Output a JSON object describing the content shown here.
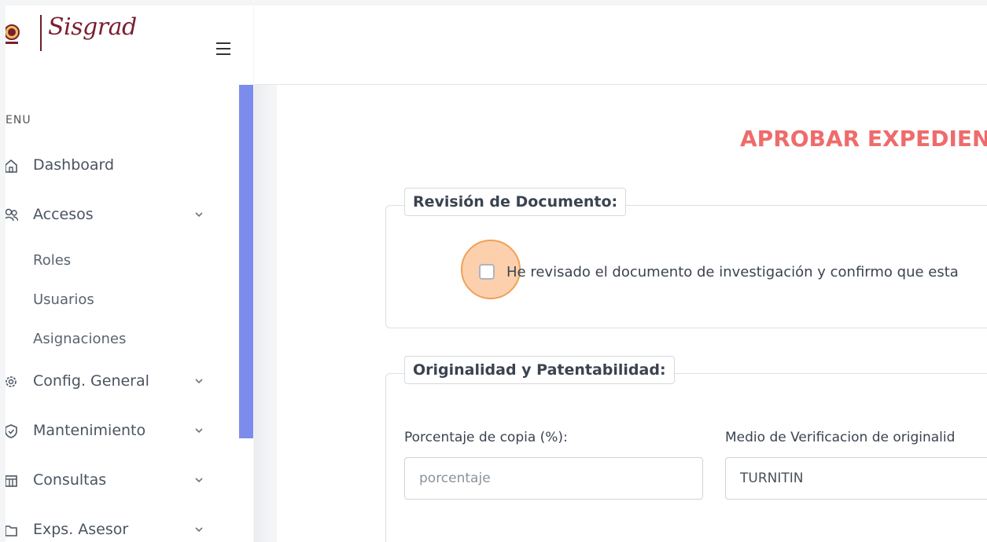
{
  "brand": {
    "name": "Sisgrad"
  },
  "sidebar": {
    "menu_heading": "ENU",
    "items": [
      {
        "label": "Dashboard",
        "icon": "home-icon",
        "has_children": false
      },
      {
        "label": "Accesos",
        "icon": "users-icon",
        "has_children": true,
        "children": [
          "Roles",
          "Usuarios",
          "Asignaciones"
        ]
      },
      {
        "label": "Config. General",
        "icon": "gear-icon",
        "has_children": true
      },
      {
        "label": "Mantenimiento",
        "icon": "shield-icon",
        "has_children": true
      },
      {
        "label": "Consultas",
        "icon": "table-icon",
        "has_children": true
      },
      {
        "label": "Exps. Asesor",
        "icon": "folder-icon",
        "has_children": true
      }
    ]
  },
  "main": {
    "title": "APROBAR EXPEDIEN",
    "review_section": {
      "legend": "Revisión de Documento:",
      "checkbox_label": "He revisado el documento de investigación y confirmo que esta",
      "checked": false
    },
    "originality_section": {
      "legend": "Originalidad y Patentabilidad:",
      "copy_percent": {
        "label": "Porcentaje de copia (%):",
        "placeholder": "porcentaje",
        "value": ""
      },
      "verification": {
        "label": "Medio de Verificacion de originalid",
        "value": "TURNITIN"
      }
    }
  },
  "colors": {
    "title": "#ef6b6b",
    "brand": "#7b1e32",
    "scrollbar": "#7b8ced",
    "highlight": "#f0a058"
  }
}
